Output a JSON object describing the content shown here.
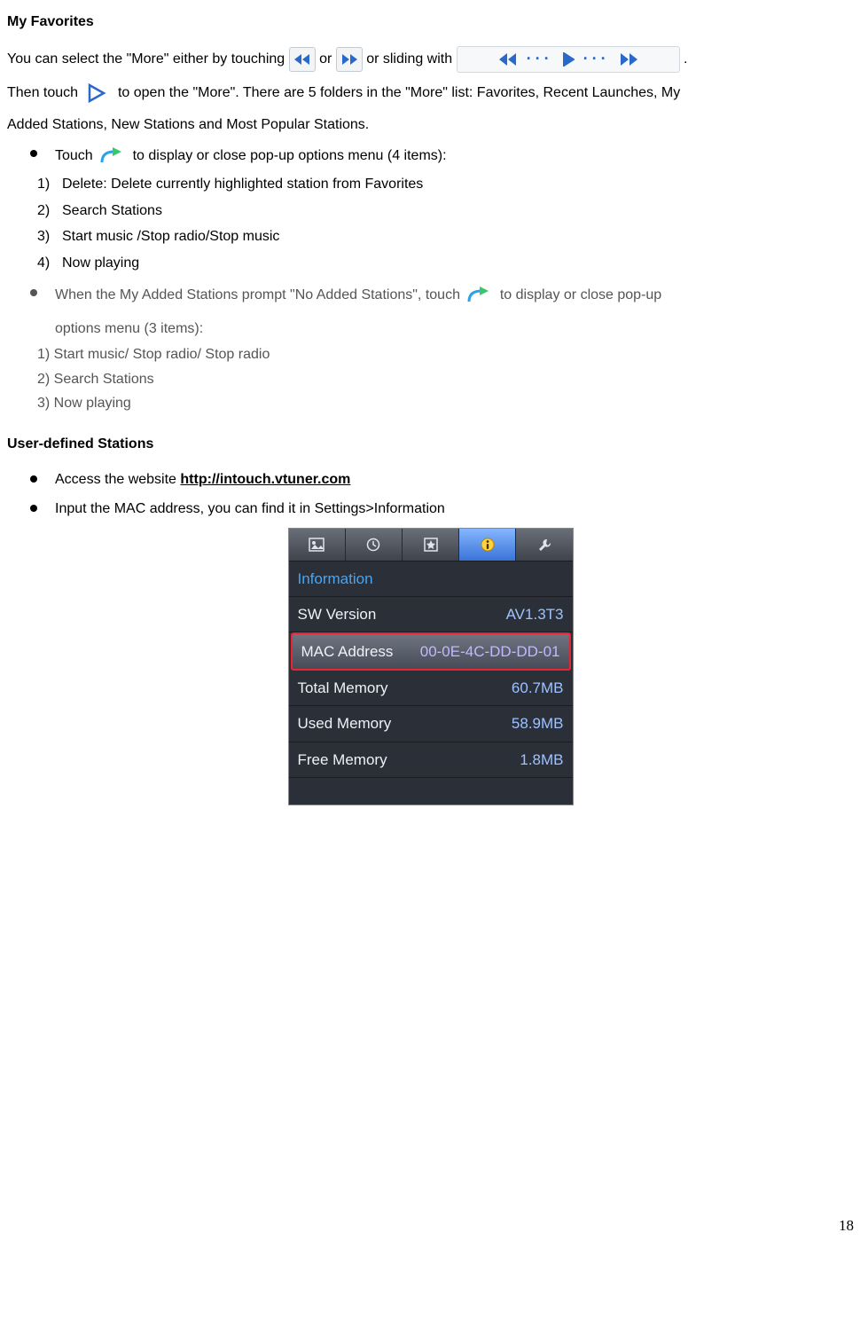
{
  "headings": {
    "my_favorites": "My Favorites",
    "user_defined": "User-defined Stations"
  },
  "para1": {
    "t1": "You can select the \"More\" either by touching ",
    "t2": " or ",
    "t3": " or sliding with ",
    "t4": "."
  },
  "para2": {
    "t1": "Then touch ",
    "t2": " to open the \"More\". There are 5 folders in the \"More\" list: Favorites, Recent Launches, My"
  },
  "para2b": "Added Stations, New Stations and Most Popular Stations.",
  "bullet1": {
    "pre": "Touch ",
    "post": " to display or close pop-up options menu (4 items):"
  },
  "ordered1": [
    "Delete: Delete currently highlighted station from Favorites",
    "Search Stations",
    "Start music /Stop radio/Stop music",
    "Now playing"
  ],
  "bullet2": {
    "pre": "When the My Added Stations prompt \"No Added Stations\", touch ",
    "post": " to display or close pop-up",
    "cont": "options menu (3 items):"
  },
  "sub2": [
    "1) Start music/ Stop radio/ Stop radio",
    "2) Search Stations",
    "3) Now playing"
  ],
  "userdef": {
    "b1a": "Access the website ",
    "b1b": "http://intouch.vtuner.com",
    "b2": "Input the MAC address, you can find it in Settings>Information"
  },
  "screenshot": {
    "header": "Information",
    "rows": [
      {
        "label": "SW Version",
        "value": "AV1.3T3"
      },
      {
        "label": "MAC Address",
        "value": "00-0E-4C-DD-DD-01"
      },
      {
        "label": "Total Memory",
        "value": "60.7MB"
      },
      {
        "label": "Used Memory",
        "value": "58.9MB"
      },
      {
        "label": "Free Memory",
        "value": "1.8MB"
      }
    ]
  },
  "page": "18"
}
